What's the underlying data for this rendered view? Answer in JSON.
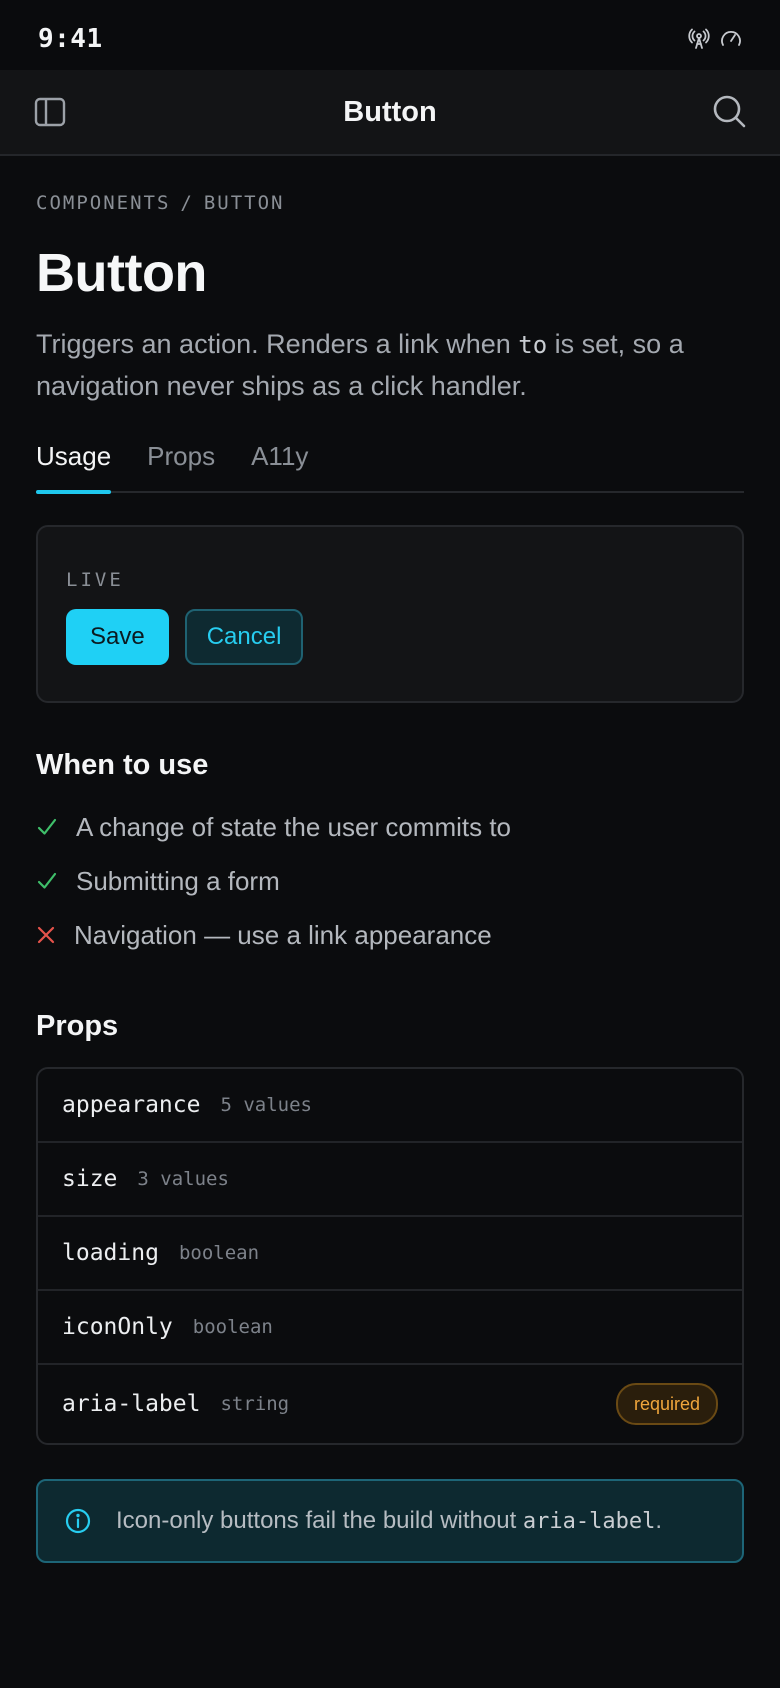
{
  "status_bar": {
    "time": "9:41",
    "icons": [
      "broadcast-icon",
      "speed-gauge-icon"
    ]
  },
  "app_bar": {
    "title": "Button",
    "left_icon": "sidebar-panel-icon",
    "right_icon": "search-icon"
  },
  "breadcrumb": {
    "parts": [
      "COMPONENTS",
      "BUTTON"
    ],
    "separator": "/"
  },
  "page": {
    "title": "Button",
    "description_before": "Triggers an action. Renders a link when ",
    "description_code": "to",
    "description_after": " is set, so a navigation never ships as a click handler."
  },
  "tabs": [
    {
      "label": "Usage",
      "active": true
    },
    {
      "label": "Props",
      "active": false
    },
    {
      "label": "A11y",
      "active": false
    }
  ],
  "live": {
    "label": "LIVE",
    "primary_label": "Save",
    "secondary_label": "Cancel"
  },
  "when_to_use": {
    "heading": "When to use",
    "items": [
      {
        "text": "A change of state the user commits to",
        "kind": "do"
      },
      {
        "text": "Submitting a form",
        "kind": "do"
      },
      {
        "text": "Navigation — use a link appearance",
        "kind": "dont"
      }
    ]
  },
  "props": {
    "heading": "Props",
    "rows": [
      {
        "name": "appearance",
        "type": "5 values",
        "badge": ""
      },
      {
        "name": "size",
        "type": "3 values",
        "badge": ""
      },
      {
        "name": "loading",
        "type": "boolean",
        "badge": ""
      },
      {
        "name": "iconOnly",
        "type": "boolean",
        "badge": ""
      },
      {
        "name": "aria-label",
        "type": "string",
        "badge": "required"
      }
    ]
  },
  "callout": {
    "text_before": "Icon-only buttons fail the build without ",
    "code": "aria-label",
    "text_after": "."
  },
  "colors": {
    "accent": "#1fd0f5",
    "do": "#3fbf6a",
    "dont": "#e5534b",
    "warning": "#f0a63c"
  }
}
